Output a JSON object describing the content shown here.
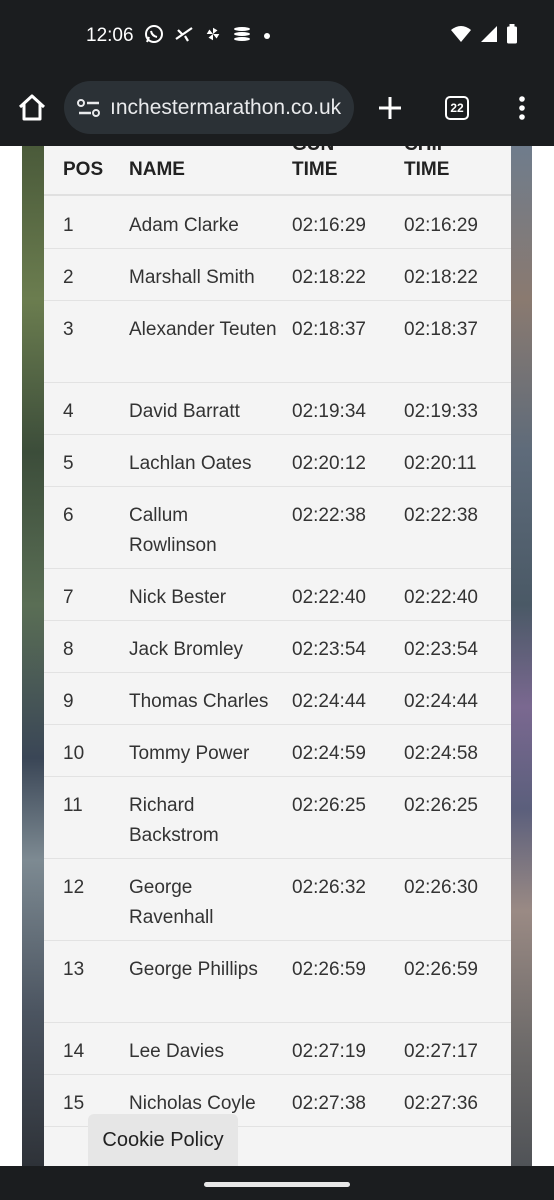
{
  "status_bar": {
    "time": "12:06",
    "icons": [
      "whatsapp-icon",
      "plane-icon",
      "pinwheel-icon",
      "stack-icon",
      "dot-icon"
    ],
    "right_icons": [
      "wifi-icon",
      "signal-icon",
      "battery-icon"
    ]
  },
  "browser": {
    "url": "ınchestermarathon.co.uk",
    "tab_count": "22"
  },
  "table": {
    "headers": {
      "pos": "POS",
      "name": "NAME",
      "gun_top": "GUN",
      "gun": "TIME",
      "chip_top": "CHIP",
      "chip": "TIME"
    },
    "rows": [
      {
        "pos": "1",
        "name": "Adam Clarke",
        "gun": "02:16:29",
        "chip": "02:16:29"
      },
      {
        "pos": "2",
        "name": "Marshall Smith",
        "gun": "02:18:22",
        "chip": "02:18:22"
      },
      {
        "pos": "3",
        "name": "Alexander Teuten",
        "gun": "02:18:37",
        "chip": "02:18:37"
      },
      {
        "pos": "4",
        "name": "David Barratt",
        "gun": "02:19:34",
        "chip": "02:19:33"
      },
      {
        "pos": "5",
        "name": "Lachlan Oates",
        "gun": "02:20:12",
        "chip": "02:20:11"
      },
      {
        "pos": "6",
        "name": "Callum Rowlinson",
        "gun": "02:22:38",
        "chip": "02:22:38"
      },
      {
        "pos": "7",
        "name": "Nick Bester",
        "gun": "02:22:40",
        "chip": "02:22:40"
      },
      {
        "pos": "8",
        "name": "Jack Bromley",
        "gun": "02:23:54",
        "chip": "02:23:54"
      },
      {
        "pos": "9",
        "name": "Thomas Charles",
        "gun": "02:24:44",
        "chip": "02:24:44"
      },
      {
        "pos": "10",
        "name": "Tommy Power",
        "gun": "02:24:59",
        "chip": "02:24:58"
      },
      {
        "pos": "11",
        "name": "Richard Backstrom",
        "gun": "02:26:25",
        "chip": "02:26:25"
      },
      {
        "pos": "12",
        "name": "George Ravenhall",
        "gun": "02:26:32",
        "chip": "02:26:30"
      },
      {
        "pos": "13",
        "name": "George Phillips",
        "gun": "02:26:59",
        "chip": "02:26:59"
      },
      {
        "pos": "14",
        "name": "Lee Davies",
        "gun": "02:27:19",
        "chip": "02:27:17"
      },
      {
        "pos": "15",
        "name": "Nicholas Coyle",
        "gun": "02:27:38",
        "chip": "02:27:36"
      }
    ]
  },
  "cookie_policy": "Cookie Policy"
}
